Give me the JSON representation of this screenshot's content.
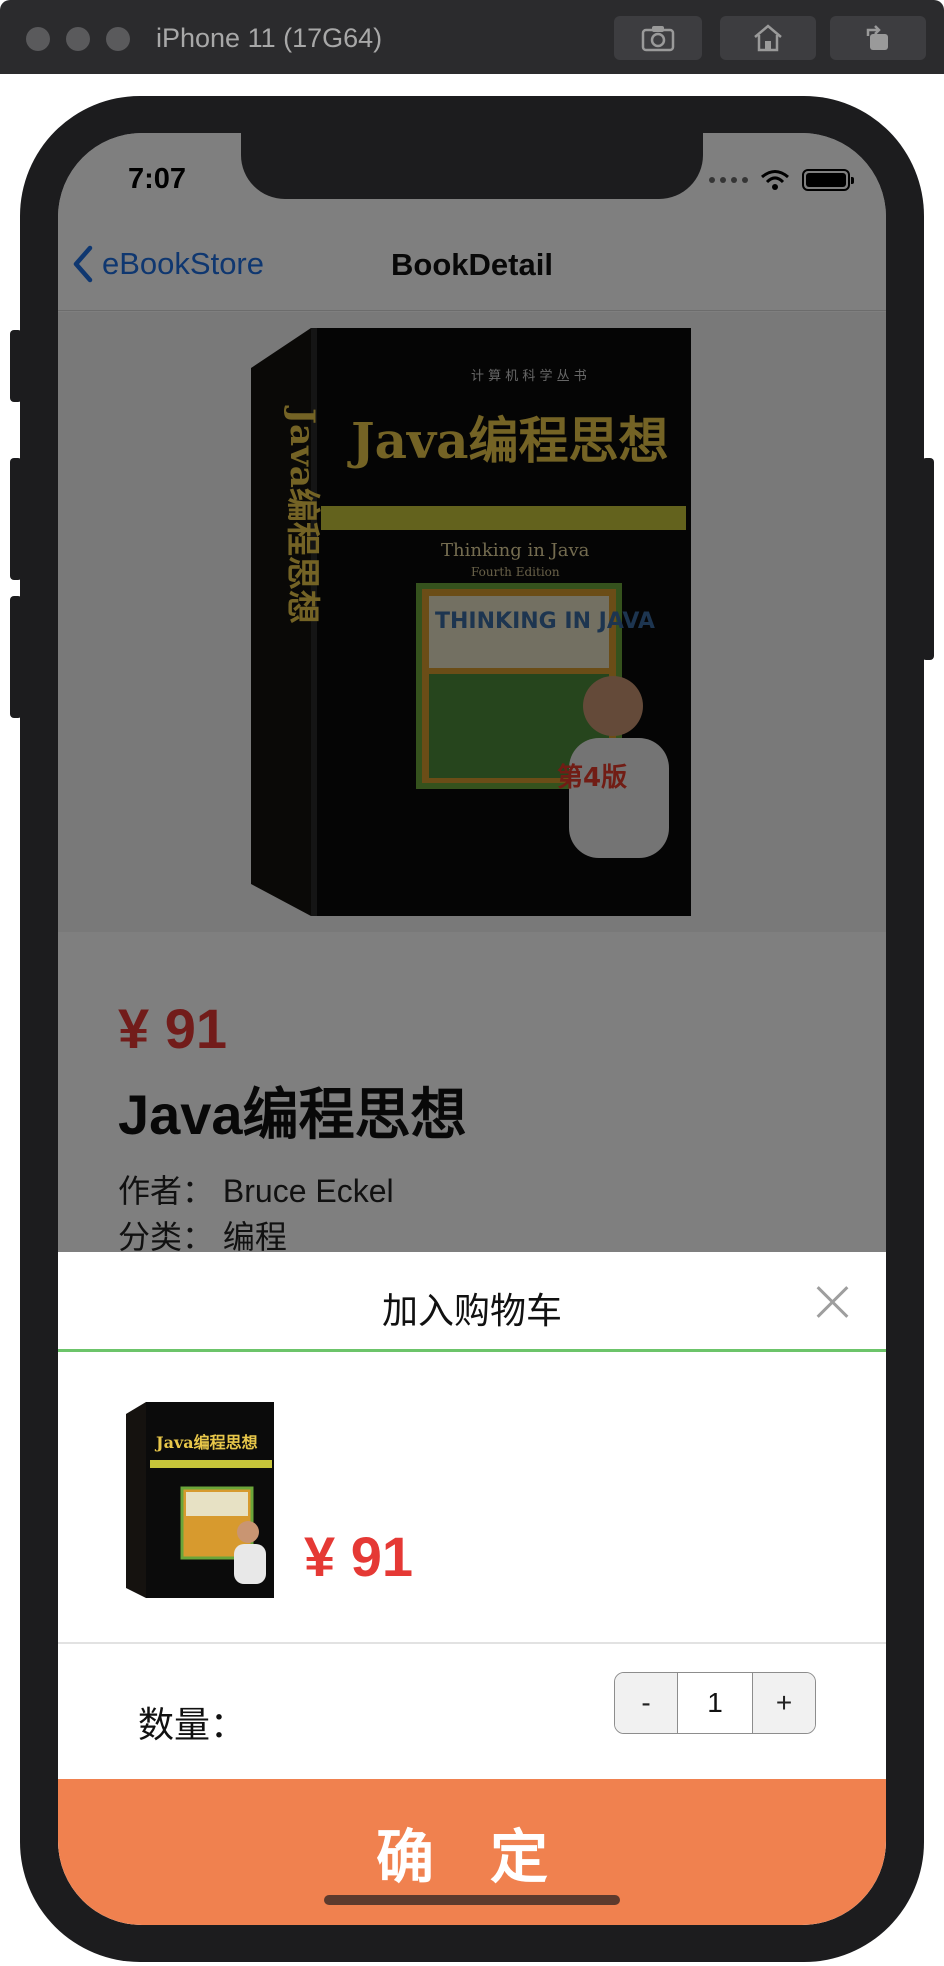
{
  "simulator": {
    "title": "iPhone 11 (17G64)",
    "buttons": [
      "screenshot-icon",
      "home-icon",
      "rotate-icon"
    ]
  },
  "status_bar": {
    "time": "7:07"
  },
  "nav": {
    "back_label": "eBookStore",
    "title": "BookDetail"
  },
  "book": {
    "price": "¥ 91",
    "title": "Java编程思想",
    "author_label": "作者：",
    "author": "Bruce Eckel",
    "category_label": "分类：",
    "category": "编程",
    "cover_series": "计 算 机 科 学 丛 书",
    "cover_title": "Java编程思想",
    "cover_subtitle": "Thinking in Java",
    "cover_edition": "Fourth Edition",
    "cover_box": "THINKING IN JAVA",
    "cover_badge": "第4版",
    "spine": "Java编程思想"
  },
  "sheet": {
    "title": "加入购物车",
    "price": "¥ 91",
    "quantity_label": "数量：",
    "quantity": "1",
    "minus": "-",
    "plus": "+",
    "confirm": "确 定"
  },
  "colors": {
    "accent": "#f0814f",
    "price": "#e53935",
    "link": "#1f6fe0",
    "divider_active": "#6cc46a"
  }
}
